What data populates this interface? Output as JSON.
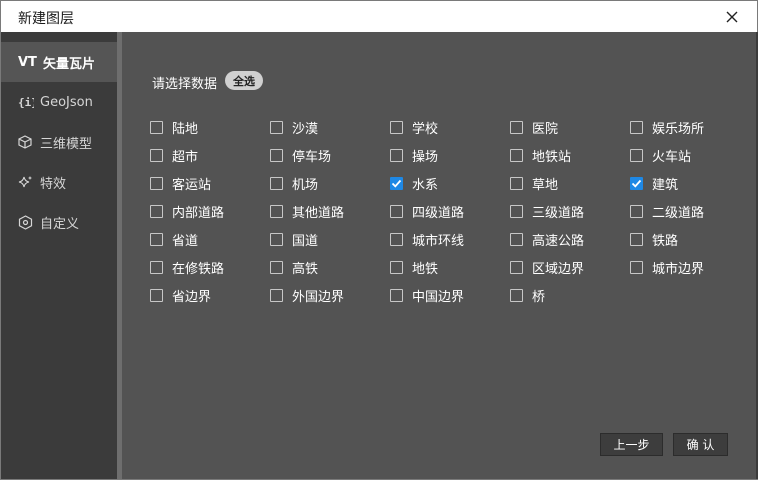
{
  "window": {
    "title": "新建图层"
  },
  "sidebar": {
    "items": [
      {
        "tag": "VT",
        "label": "矢量瓦片",
        "icon": "vt-text-icon",
        "active": true
      },
      {
        "label": "GeoJson",
        "icon": "braces-info-icon",
        "active": false
      },
      {
        "label": "三维模型",
        "icon": "cube-icon",
        "active": false
      },
      {
        "label": "特效",
        "icon": "sparkle-icon",
        "active": false
      },
      {
        "label": "自定义",
        "icon": "hexagon-icon",
        "active": false
      }
    ]
  },
  "main": {
    "prompt": "请选择数据",
    "select_all": "全选",
    "options": [
      {
        "label": "陆地",
        "checked": false
      },
      {
        "label": "沙漠",
        "checked": false
      },
      {
        "label": "学校",
        "checked": false
      },
      {
        "label": "医院",
        "checked": false
      },
      {
        "label": "娱乐场所",
        "checked": false
      },
      {
        "label": "超市",
        "checked": false
      },
      {
        "label": "停车场",
        "checked": false
      },
      {
        "label": "操场",
        "checked": false
      },
      {
        "label": "地铁站",
        "checked": false
      },
      {
        "label": "火车站",
        "checked": false
      },
      {
        "label": "客运站",
        "checked": false
      },
      {
        "label": "机场",
        "checked": false
      },
      {
        "label": "水系",
        "checked": true
      },
      {
        "label": "草地",
        "checked": false
      },
      {
        "label": "建筑",
        "checked": true
      },
      {
        "label": "内部道路",
        "checked": false
      },
      {
        "label": "其他道路",
        "checked": false
      },
      {
        "label": "四级道路",
        "checked": false
      },
      {
        "label": "三级道路",
        "checked": false
      },
      {
        "label": "二级道路",
        "checked": false
      },
      {
        "label": "省道",
        "checked": false
      },
      {
        "label": "国道",
        "checked": false
      },
      {
        "label": "城市环线",
        "checked": false
      },
      {
        "label": "高速公路",
        "checked": false
      },
      {
        "label": "铁路",
        "checked": false
      },
      {
        "label": "在修铁路",
        "checked": false
      },
      {
        "label": "高铁",
        "checked": false
      },
      {
        "label": "地铁",
        "checked": false
      },
      {
        "label": "区域边界",
        "checked": false
      },
      {
        "label": "城市边界",
        "checked": false
      },
      {
        "label": "省边界",
        "checked": false
      },
      {
        "label": "外国边界",
        "checked": false
      },
      {
        "label": "中国边界",
        "checked": false
      },
      {
        "label": "桥",
        "checked": false
      }
    ]
  },
  "footer": {
    "prev_label": "上一步",
    "confirm_label": "确 认"
  },
  "colors": {
    "accent": "#1e88e5",
    "sidebar_bg": "#3b3b3b",
    "content_bg": "#535353"
  }
}
